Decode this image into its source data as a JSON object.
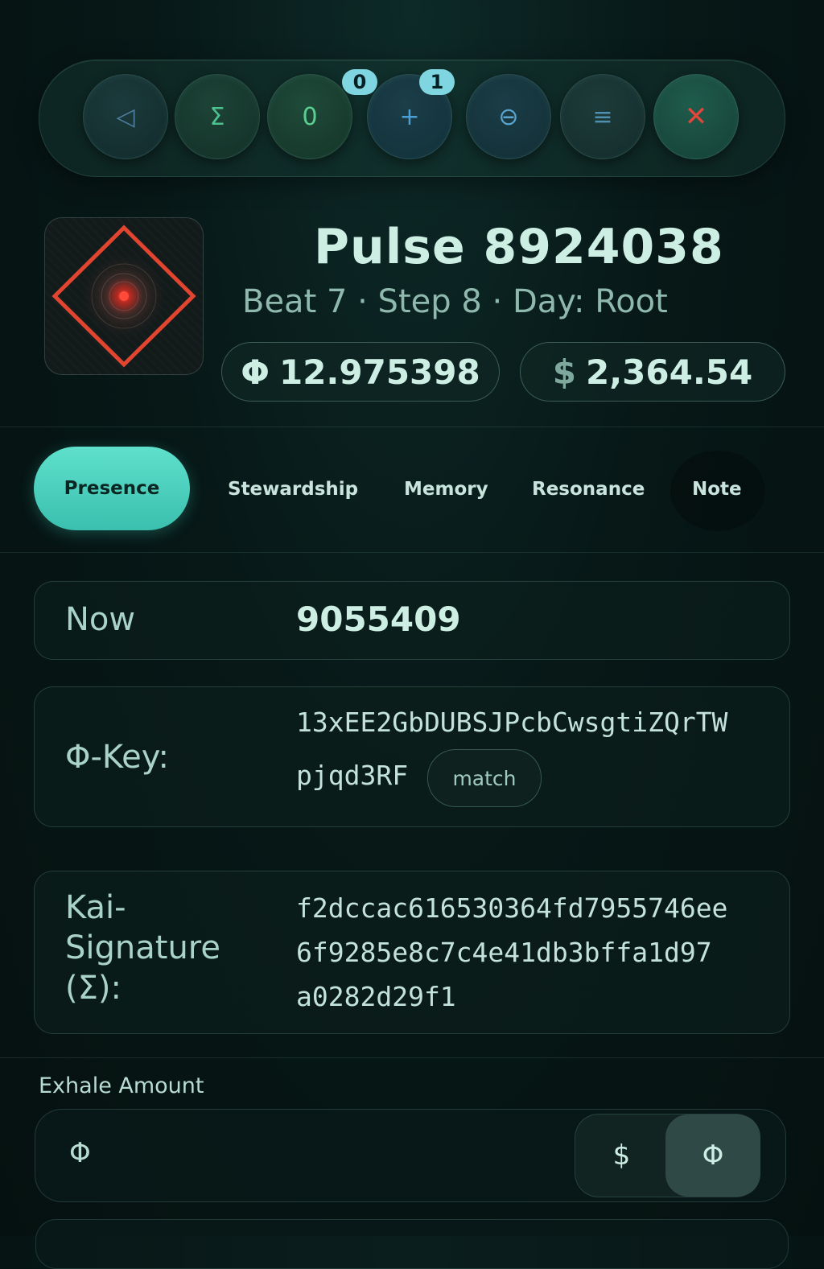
{
  "toolbar": {
    "buttons": [
      {
        "icon": "send-icon",
        "glyph": "◁"
      },
      {
        "icon": "sigma-icon",
        "glyph": "Σ"
      },
      {
        "icon": "zero-icon",
        "glyph": "0"
      },
      {
        "icon": "plus-icon",
        "glyph": "+"
      },
      {
        "icon": "theta-icon",
        "glyph": "⊖"
      },
      {
        "icon": "menu-icon",
        "glyph": "≡"
      },
      {
        "icon": "close-icon",
        "glyph": "✕"
      }
    ],
    "badges": [
      "0",
      "1"
    ]
  },
  "header": {
    "title": "Pulse 8924038",
    "subtitle": "Beat 7 · Step 8 · Day: Root",
    "phi_symbol": "Φ",
    "phi_value": "12.975398",
    "usd_symbol": "$",
    "usd_value": "2,364.54"
  },
  "tabs": [
    "Presence",
    "Stewardship",
    "Memory",
    "Resonance",
    "Note"
  ],
  "details": {
    "now_label": "Now",
    "now_value": "9055409",
    "phikey_label": "Φ-Key:",
    "phikey_line1": "13xEE2GbDUBSJPcbCwsgtiZQrTW",
    "phikey_line2": "pjqd3RF",
    "match_label": "match",
    "sig_label_1": "Kai-",
    "sig_label_2": "Signature",
    "sig_label_3": "(Σ):",
    "sig_line1": "f2dccac616530364fd7955746ee",
    "sig_line2": "6f9285e8c7c4e41db3bffa1d97",
    "sig_line3": "a0282d29f1"
  },
  "exhale": {
    "label": "Exhale Amount",
    "prefix": "Φ",
    "value": "",
    "unit_usd": "$",
    "unit_phi": "Φ",
    "selected_unit": "Φ"
  },
  "colors": {
    "accent": "#4fd8c4",
    "close": "#e3463a",
    "sigil_red": "#e2452f"
  }
}
